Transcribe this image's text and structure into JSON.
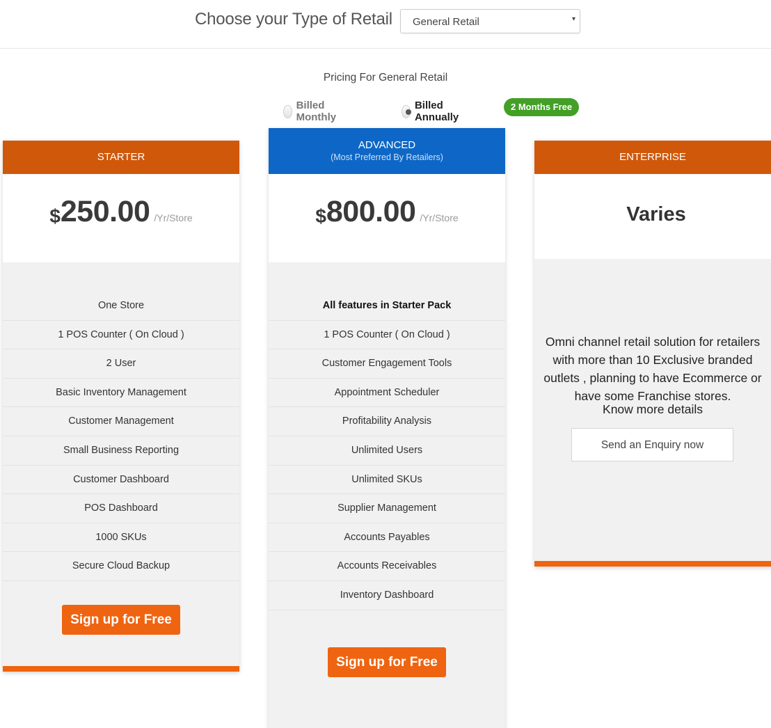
{
  "header": {
    "title": "Choose your Type of Retail",
    "retail_select": {
      "value": "General Retail",
      "caret": "▾"
    }
  },
  "pricing_for": "Pricing For General Retail",
  "billing": {
    "options": [
      {
        "label": "Billed Monthly",
        "checked": false
      },
      {
        "label": "Billed Annually",
        "checked": true
      }
    ],
    "badge": "2 Months Free"
  },
  "colors": {
    "orange_header": "#d0580a",
    "orange_button": "#ef6411",
    "blue_header": "#0e67c6",
    "green_badge": "#43a026"
  },
  "plans": {
    "starter": {
      "name": "STARTER",
      "currency": "$",
      "price": "250.00",
      "per": "/Yr/Store",
      "features": [
        "One Store",
        "1 POS Counter ( On Cloud )",
        "2 User",
        "Basic Inventory Management",
        "Customer Management",
        "Small Business Reporting",
        "Customer Dashboard",
        "POS Dashboard",
        "1000 SKUs",
        "Secure Cloud Backup"
      ],
      "cta": "Sign up for Free"
    },
    "advanced": {
      "name": "ADVANCED",
      "subtitle": "(Most Preferred By Retailers)",
      "currency": "$",
      "price": "800.00",
      "per": "/Yr/Store",
      "features": [
        "All features in Starter Pack",
        "1 POS Counter ( On Cloud )",
        "Customer Engagement Tools",
        "Appointment Scheduler",
        "Profitability Analysis",
        "Unlimited Users",
        "Unlimited SKUs",
        "Supplier Management",
        "Accounts Payables",
        "Accounts Receivables",
        "Inventory Dashboard"
      ],
      "cta": "Sign up for Free"
    },
    "enterprise": {
      "name": "ENTERPRISE",
      "price": "Varies",
      "description": "Omni channel retail solution for retailers with more than 10 Exclusive branded outlets , planning to have Ecommerce or have some Franchise stores.",
      "more": "Know more details",
      "cta": "Send an Enquiry now"
    }
  }
}
